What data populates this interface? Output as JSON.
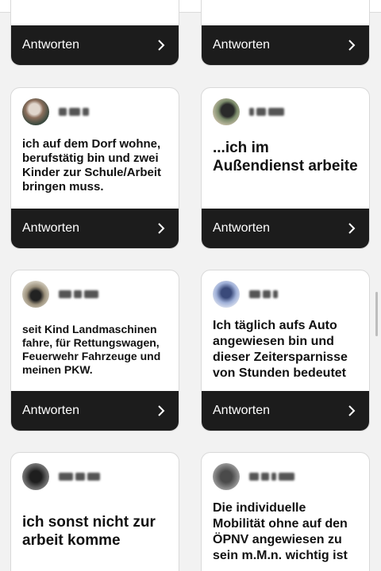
{
  "reply_label": "Antworten",
  "cards": [
    {
      "answer": ""
    },
    {
      "answer": ""
    },
    {
      "answer": "ich auf dem Dorf wohne, berufstätig bin und zwei Kinder zur Schule/Arbeit bringen muss."
    },
    {
      "answer": "...ich im Außendienst arbeite"
    },
    {
      "answer": "seit Kind Landmaschinen fahre, für Rettungswagen, Feuerwehr Fahrzeuge und meinen PKW."
    },
    {
      "answer": "Ich täglich aufs Auto angewiesen bin und dieser Zeitersparnisse von Stunden bedeutet"
    },
    {
      "answer": "ich sonst nicht zur arbeit komme"
    },
    {
      "answer": "Die individuelle Mobilität ohne auf den ÖPNV angewiesen zu sein m.M.n. wichtig ist"
    }
  ],
  "colors": {
    "reply_bg": "#1c1c1c",
    "card_bg": "#ffffff",
    "page_bg": "#f2f2f2"
  }
}
